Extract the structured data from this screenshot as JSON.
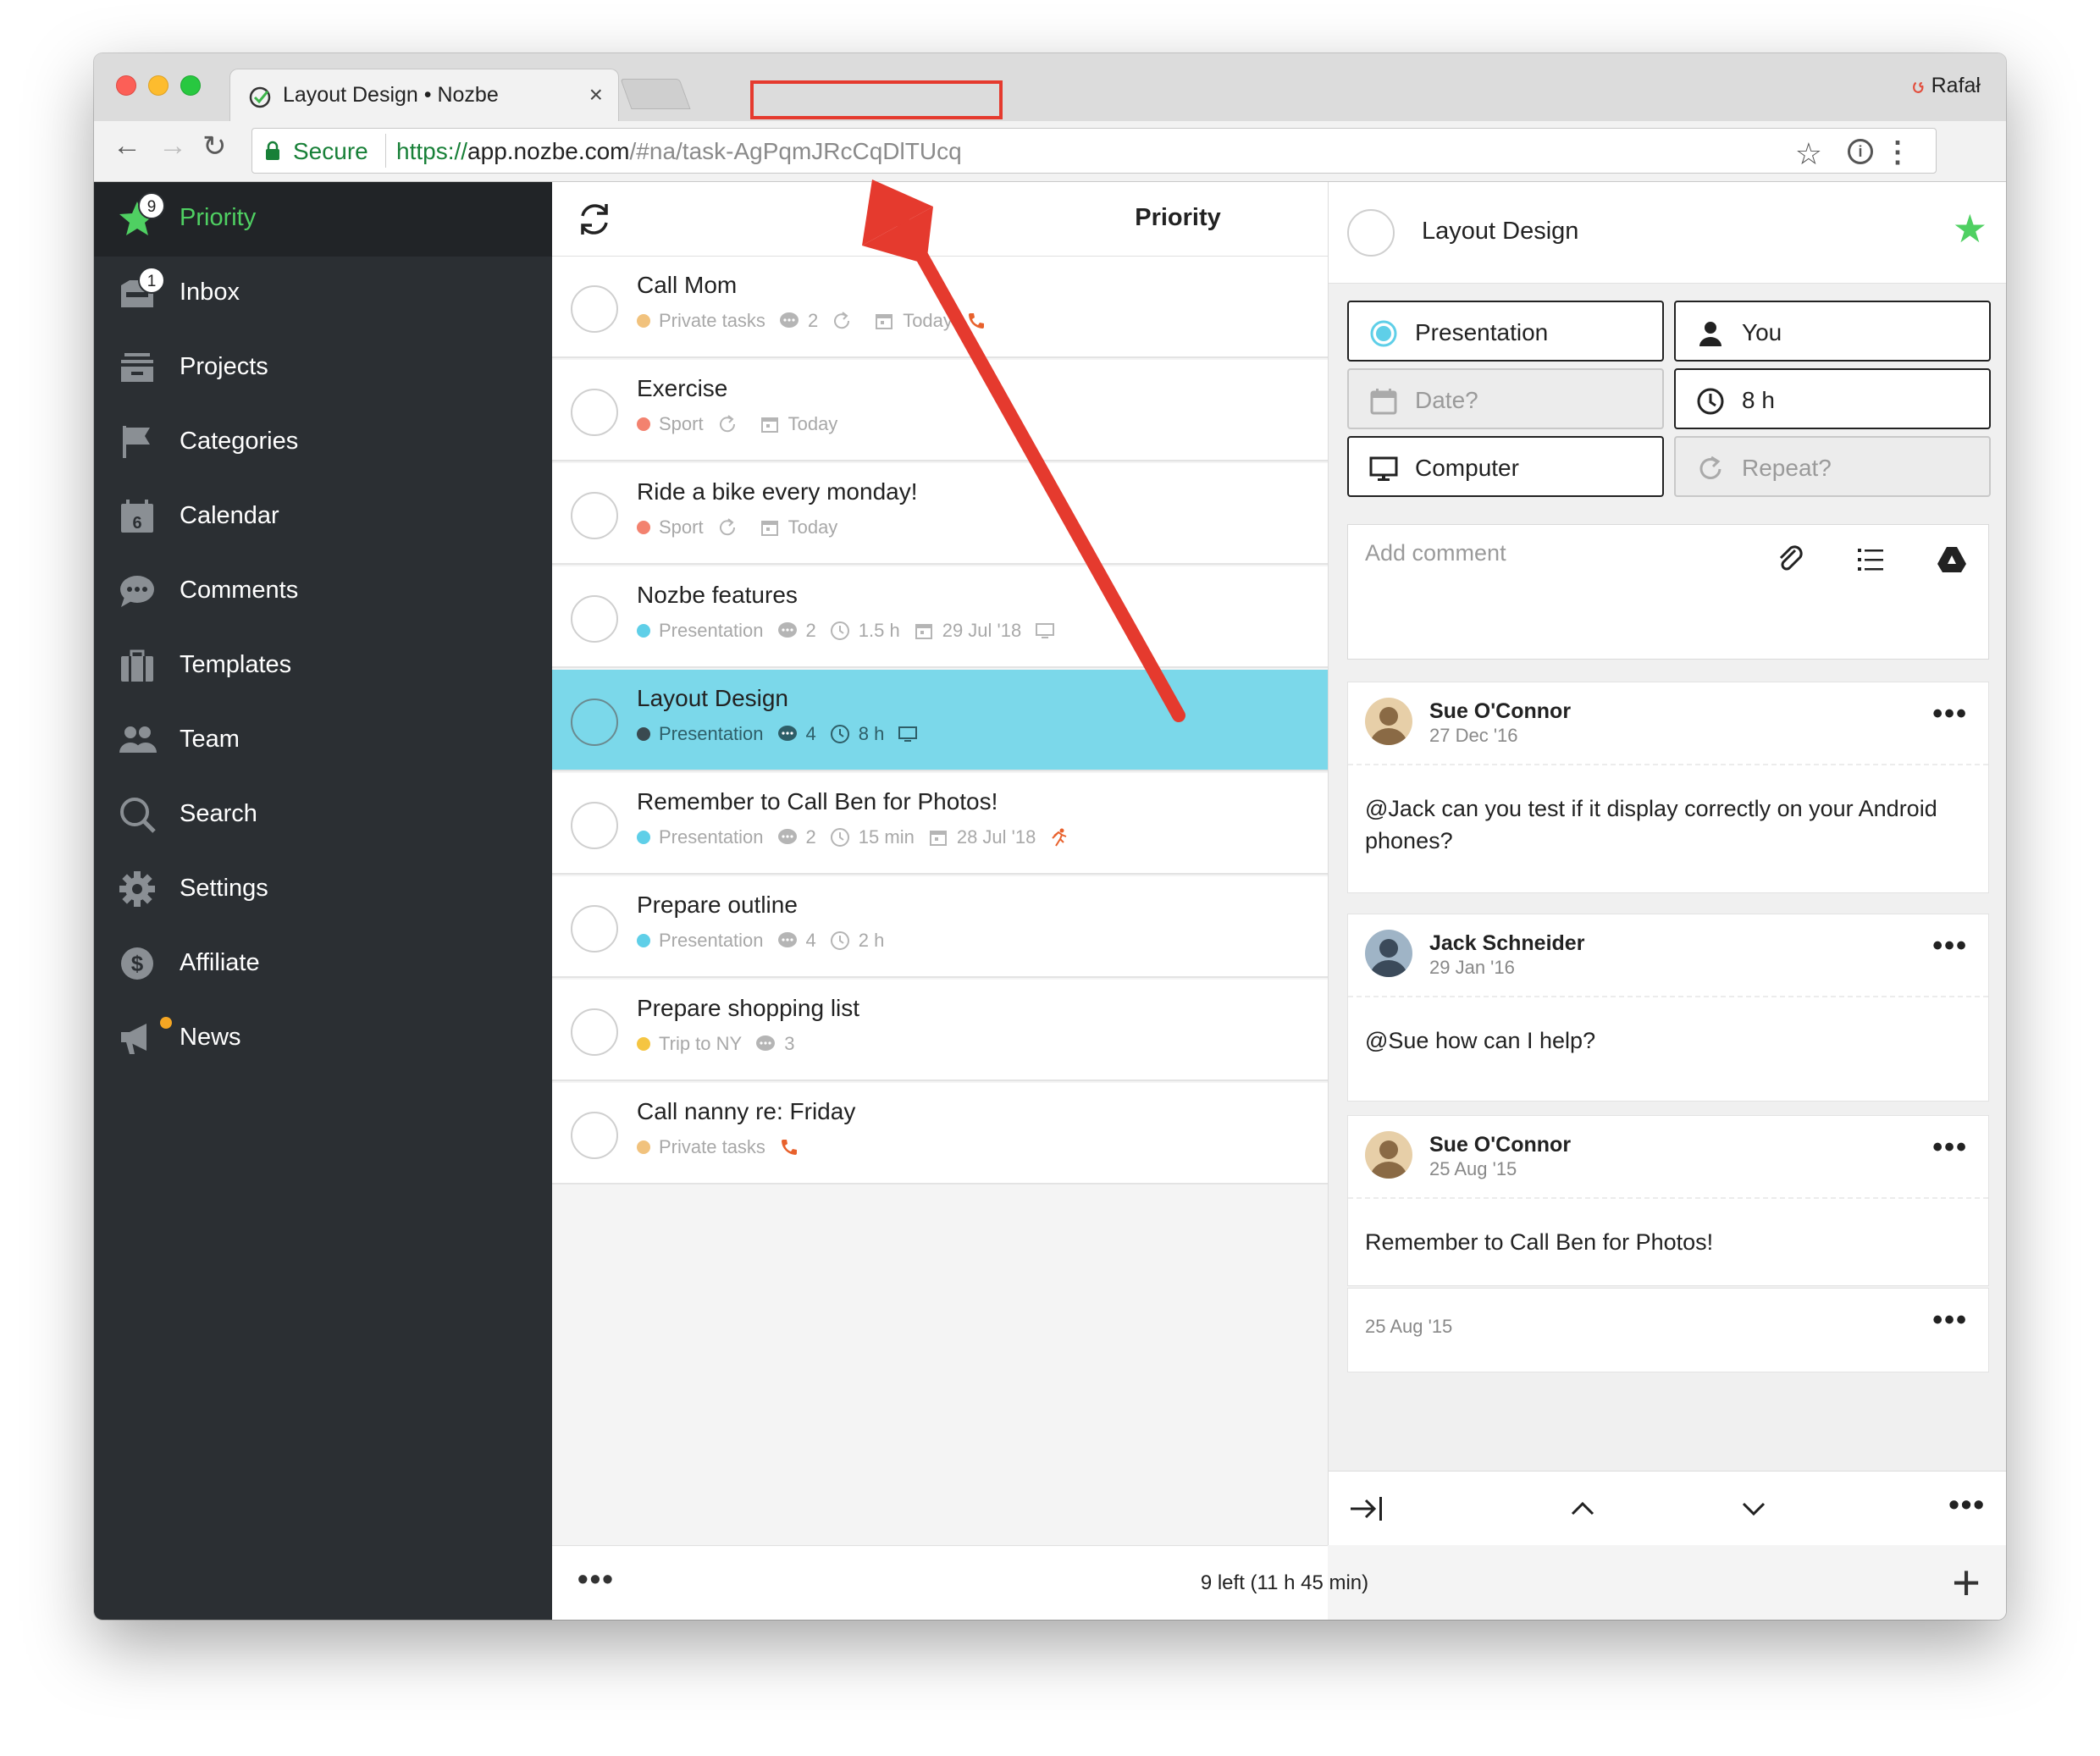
{
  "browser": {
    "tab_title": "Layout Design • Nozbe",
    "tab_close": "×",
    "profile_name": "Rafał",
    "secure_label": "Secure",
    "url_scheme": "https://",
    "url_host": "app.nozbe.com",
    "url_path": "/#na/task-AgPqmJRcCqDlTUcq"
  },
  "sidebar": {
    "items": [
      {
        "label": "Priority",
        "icon": "star-icon",
        "badge": "9",
        "active": true
      },
      {
        "label": "Inbox",
        "icon": "inbox-icon",
        "badge": "1"
      },
      {
        "label": "Projects",
        "icon": "projects-icon"
      },
      {
        "label": "Categories",
        "icon": "flag-icon"
      },
      {
        "label": "Calendar",
        "icon": "calendar-icon",
        "day": "6"
      },
      {
        "label": "Comments",
        "icon": "comments-icon"
      },
      {
        "label": "Templates",
        "icon": "templates-icon"
      },
      {
        "label": "Team",
        "icon": "team-icon"
      },
      {
        "label": "Search",
        "icon": "search-icon"
      },
      {
        "label": "Settings",
        "icon": "gear-icon"
      },
      {
        "label": "Affiliate",
        "icon": "dollar-icon"
      },
      {
        "label": "News",
        "icon": "megaphone-icon"
      }
    ]
  },
  "list": {
    "title": "Priority",
    "footer_status": "9 left (11 h 45 min)",
    "tasks": [
      {
        "title": "Call Mom",
        "project": "Private tasks",
        "project_color": "#f1c27d",
        "comments": "2",
        "repeat": true,
        "date": "Today",
        "phone": true
      },
      {
        "title": "Exercise",
        "project": "Sport",
        "project_color": "#f3826f",
        "repeat": true,
        "date": "Today"
      },
      {
        "title": "Ride a bike every monday!",
        "project": "Sport",
        "project_color": "#f3826f",
        "repeat": true,
        "date": "Today"
      },
      {
        "title": "Nozbe features",
        "project": "Presentation",
        "project_color": "#5fcfe8",
        "comments": "2",
        "time": "1.5 h",
        "date": "29 Jul '18",
        "computer": true
      },
      {
        "title": "Layout Design",
        "project": "Presentation",
        "project_color": "#3a4a50",
        "comments": "4",
        "time": "8 h",
        "computer": true,
        "selected": true
      },
      {
        "title": "Remember to Call Ben for Photos!",
        "project": "Presentation",
        "project_color": "#5fcfe8",
        "comments": "2",
        "time": "15 min",
        "date": "28 Jul '18",
        "run": true
      },
      {
        "title": "Prepare outline",
        "project": "Presentation",
        "project_color": "#5fcfe8",
        "comments": "4",
        "time": "2 h"
      },
      {
        "title": "Prepare shopping list",
        "project": "Trip to NY",
        "project_color": "#f5c542",
        "comments": "3"
      },
      {
        "title": "Call nanny re: Friday",
        "project": "Private tasks",
        "project_color": "#f1c27d",
        "phone": true
      }
    ]
  },
  "detail": {
    "title": "Layout Design",
    "attributes": {
      "project": "Presentation",
      "responsible": "You",
      "date": "Date?",
      "time": "8 h",
      "category": "Computer",
      "repeat": "Repeat?"
    },
    "comment_placeholder": "Add comment",
    "comments": [
      {
        "author": "Sue O'Connor",
        "date": "27 Dec '16",
        "text": "@Jack can you test if it display correctly on your Android phones?"
      },
      {
        "author": "Jack Schneider",
        "date": "29 Jan '16",
        "text": "@Sue how can I help?"
      },
      {
        "author": "Sue O'Connor",
        "date": "25 Aug '15",
        "text": "Remember to Call Ben for Photos!"
      }
    ],
    "extra_date": "25 Aug '15"
  },
  "colors": {
    "accent_green": "#4fd062",
    "selected_row": "#7bd8ea",
    "sidebar": "#2b2f33",
    "annotation_red": "#e53a2e"
  }
}
